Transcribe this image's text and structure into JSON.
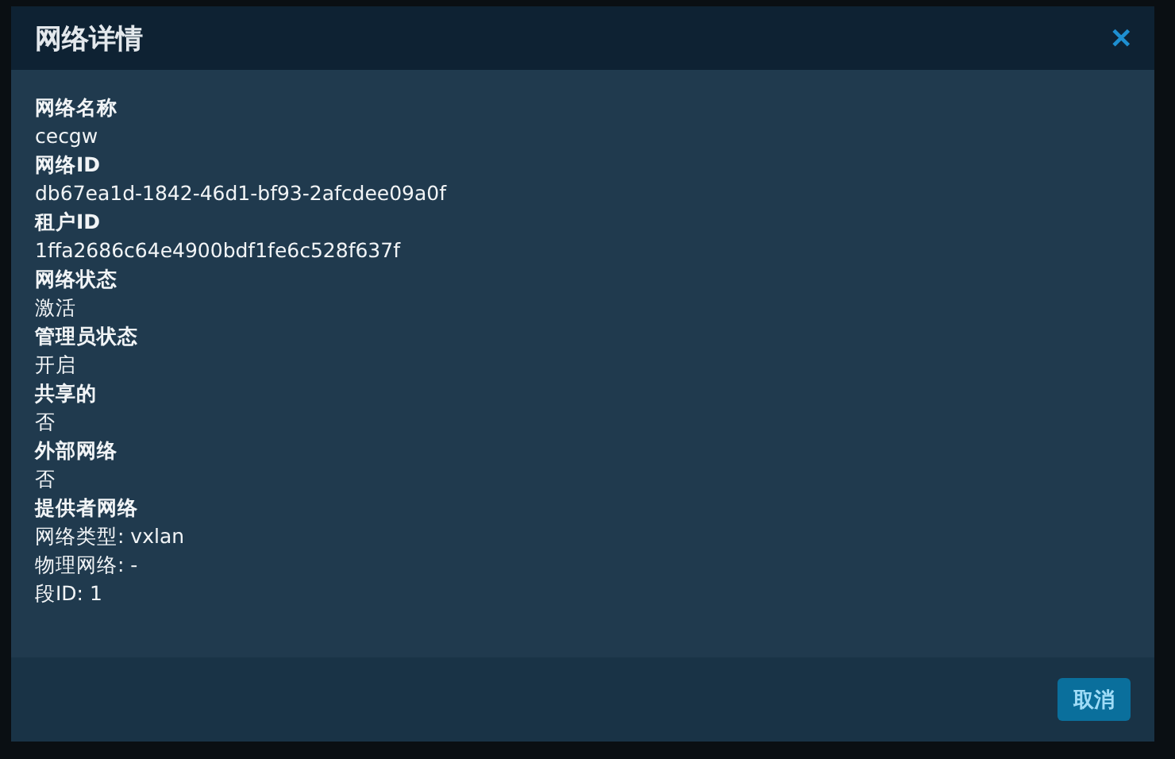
{
  "dialog": {
    "title": "网络详情",
    "close_icon": "✕"
  },
  "fields": [
    {
      "label": "网络名称",
      "values": [
        "cecgw"
      ]
    },
    {
      "label": "网络ID",
      "values": [
        "db67ea1d-1842-46d1-bf93-2afcdee09a0f"
      ]
    },
    {
      "label": "租户ID",
      "values": [
        "1ffa2686c64e4900bdf1fe6c528f637f"
      ]
    },
    {
      "label": "网络状态",
      "values": [
        "激活"
      ]
    },
    {
      "label": "管理员状态",
      "values": [
        "开启"
      ]
    },
    {
      "label": "共享的",
      "values": [
        "否"
      ]
    },
    {
      "label": "外部网络",
      "values": [
        "否"
      ]
    },
    {
      "label": "提供者网络",
      "values": [
        "网络类型: vxlan",
        "物理网络: -",
        "段ID: 1"
      ]
    }
  ],
  "buttons": [
    "取消"
  ]
}
